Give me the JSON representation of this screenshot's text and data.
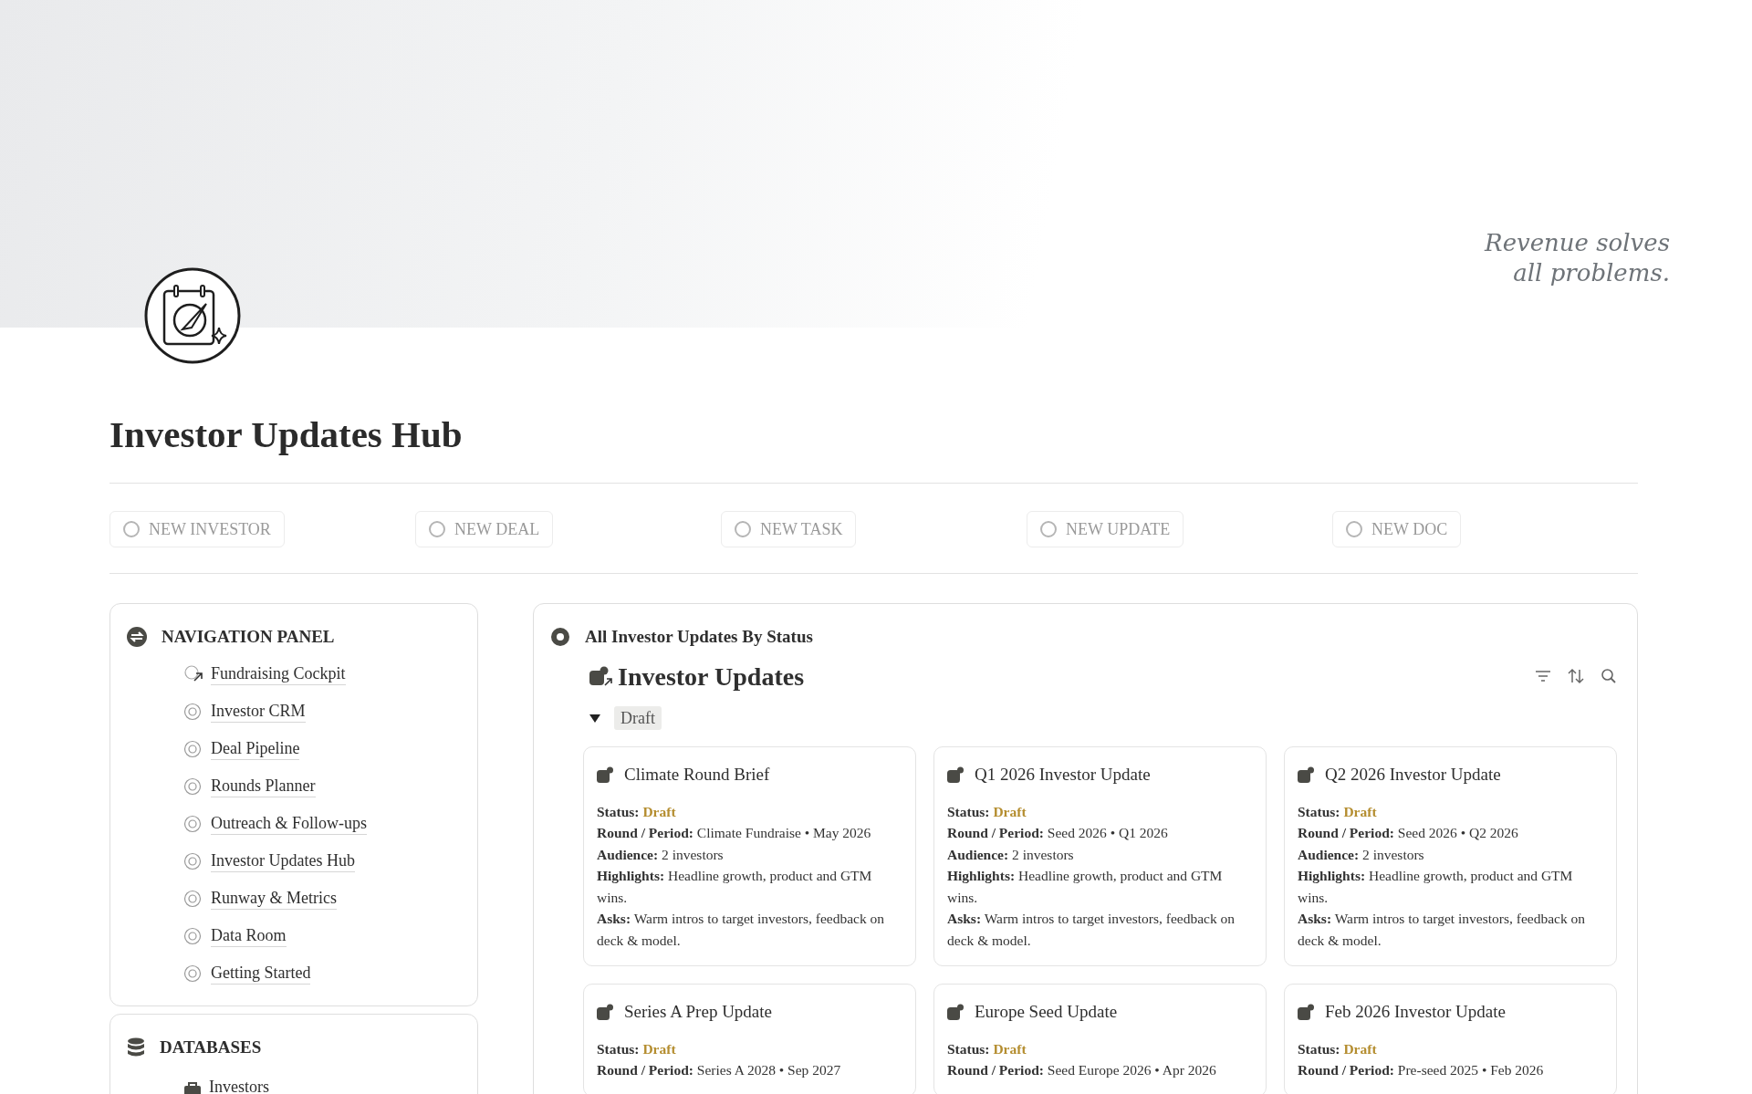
{
  "cover": {
    "quote": [
      "Revenue solves",
      "all problems."
    ]
  },
  "page": {
    "title": "Investor Updates Hub"
  },
  "quick_actions": [
    {
      "label": "NEW INVESTOR"
    },
    {
      "label": "NEW DEAL"
    },
    {
      "label": "NEW TASK"
    },
    {
      "label": "NEW UPDATE"
    },
    {
      "label": "NEW DOC"
    }
  ],
  "navigation_panel": {
    "title": "NAVIGATION PANEL",
    "items": [
      {
        "label": "Fundraising Cockpit",
        "kind": "link"
      },
      {
        "label": "Investor CRM",
        "kind": "page"
      },
      {
        "label": "Deal Pipeline",
        "kind": "page"
      },
      {
        "label": "Rounds Planner",
        "kind": "page"
      },
      {
        "label": "Outreach & Follow-ups",
        "kind": "page"
      },
      {
        "label": "Investor Updates Hub",
        "kind": "page"
      },
      {
        "label": "Runway & Metrics",
        "kind": "page"
      },
      {
        "label": "Data Room",
        "kind": "page"
      },
      {
        "label": "Getting Started",
        "kind": "page"
      }
    ]
  },
  "databases_panel": {
    "title": "DATABASES",
    "items": [
      {
        "label": "Investors"
      }
    ]
  },
  "board": {
    "view_title": "All Investor Updates By Status",
    "database_title": "Investor Updates",
    "group": {
      "label": "Draft",
      "expanded": true
    },
    "cards": [
      {
        "title": "Climate Round Brief",
        "fields": [
          {
            "label": "Status:",
            "value": "Draft",
            "kind": "status"
          },
          {
            "label": "Round / Period:",
            "value": "Climate Fundraise • May 2026",
            "kind": "text"
          },
          {
            "label": "Audience:",
            "value": "2 investors",
            "kind": "text"
          },
          {
            "label": "Highlights:",
            "value": "Headline growth, product and GTM wins.",
            "kind": "text"
          },
          {
            "label": "Asks:",
            "value": "Warm intros to target investors, feedback on deck & model.",
            "kind": "text"
          }
        ]
      },
      {
        "title": "Q1 2026 Investor Update",
        "fields": [
          {
            "label": "Status:",
            "value": "Draft",
            "kind": "status"
          },
          {
            "label": "Round / Period:",
            "value": "Seed 2026 • Q1 2026",
            "kind": "text"
          },
          {
            "label": "Audience:",
            "value": "2 investors",
            "kind": "text"
          },
          {
            "label": "Highlights:",
            "value": "Headline growth, product and GTM wins.",
            "kind": "text"
          },
          {
            "label": "Asks:",
            "value": "Warm intros to target investors, feedback on deck & model.",
            "kind": "text"
          }
        ]
      },
      {
        "title": "Q2 2026 Investor Update",
        "fields": [
          {
            "label": "Status:",
            "value": "Draft",
            "kind": "status"
          },
          {
            "label": "Round / Period:",
            "value": "Seed 2026 • Q2 2026",
            "kind": "text"
          },
          {
            "label": "Audience:",
            "value": "2 investors",
            "kind": "text"
          },
          {
            "label": "Highlights:",
            "value": "Headline growth, product and GTM wins.",
            "kind": "text"
          },
          {
            "label": "Asks:",
            "value": "Warm intros to target investors, feedback on deck & model.",
            "kind": "text"
          }
        ]
      },
      {
        "title": "Series A Prep Update",
        "fields": [
          {
            "label": "Status:",
            "value": "Draft",
            "kind": "status"
          },
          {
            "label": "Round / Period:",
            "value": "Series A 2028 • Sep 2027",
            "kind": "text"
          }
        ]
      },
      {
        "title": "Europe Seed Update",
        "fields": [
          {
            "label": "Status:",
            "value": "Draft",
            "kind": "status"
          },
          {
            "label": "Round / Period:",
            "value": "Seed Europe 2026 • Apr 2026",
            "kind": "text"
          }
        ]
      },
      {
        "title": "Feb 2026 Investor Update",
        "fields": [
          {
            "label": "Status:",
            "value": "Draft",
            "kind": "status"
          },
          {
            "label": "Round / Period:",
            "value": "Pre-seed 2025 • Feb 2026",
            "kind": "text"
          }
        ]
      }
    ]
  }
}
